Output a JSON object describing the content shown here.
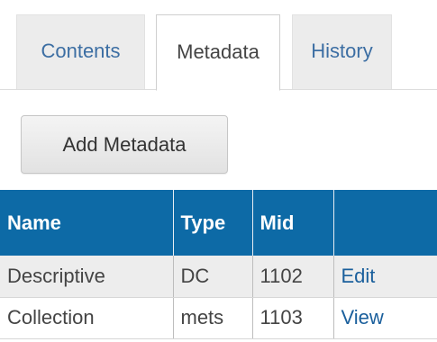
{
  "tabs": [
    {
      "label": "Contents",
      "active": false
    },
    {
      "label": "Metadata",
      "active": true
    },
    {
      "label": "History",
      "active": false
    }
  ],
  "toolbar": {
    "add_metadata_label": "Add Metadata"
  },
  "table": {
    "columns": [
      "Name",
      "Type",
      "Mid",
      ""
    ],
    "rows": [
      {
        "name": "Descriptive",
        "type": "DC",
        "mid": "1102",
        "action": "Edit"
      },
      {
        "name": "Collection",
        "type": "mets",
        "mid": "1103",
        "action": "View"
      }
    ]
  },
  "colors": {
    "header_bg": "#0d6aa6",
    "tab_link": "#3c6ea3",
    "action_link": "#1a5f9c"
  }
}
